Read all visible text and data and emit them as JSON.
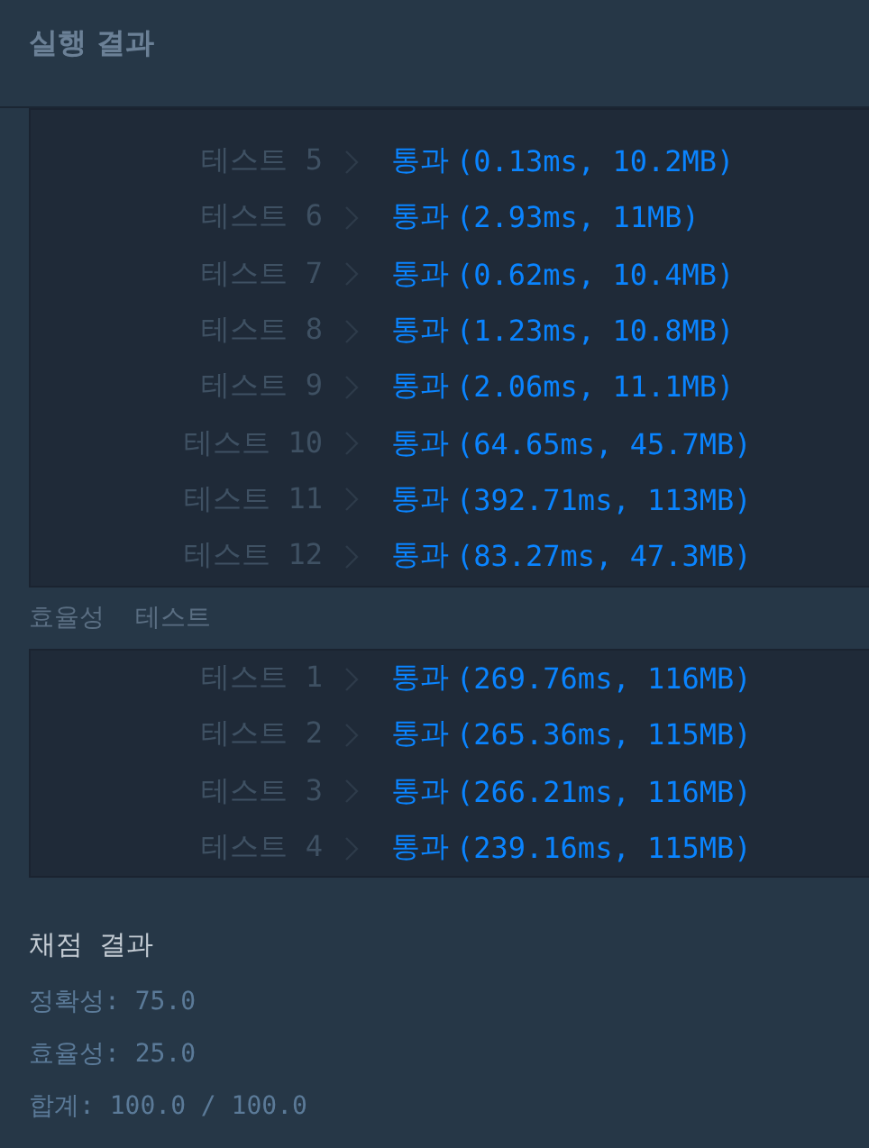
{
  "header": {
    "title": "실행 결과"
  },
  "accuracy_tests": [
    {
      "label": "테스트 5",
      "result": "통과",
      "detail": "(0.13ms, 10.2MB)"
    },
    {
      "label": "테스트 6",
      "result": "통과",
      "detail": "(2.93ms, 11MB)"
    },
    {
      "label": "테스트 7",
      "result": "통과",
      "detail": "(0.62ms, 10.4MB)"
    },
    {
      "label": "테스트 8",
      "result": "통과",
      "detail": "(1.23ms, 10.8MB)"
    },
    {
      "label": "테스트 9",
      "result": "통과",
      "detail": "(2.06ms, 11.1MB)"
    },
    {
      "label": "테스트 10",
      "result": "통과",
      "detail": "(64.65ms, 45.7MB)"
    },
    {
      "label": "테스트 11",
      "result": "통과",
      "detail": "(392.71ms, 113MB)"
    },
    {
      "label": "테스트 12",
      "result": "통과",
      "detail": "(83.27ms, 47.3MB)"
    }
  ],
  "efficiency": {
    "title": "효율성  테스트",
    "tests": [
      {
        "label": "테스트 1",
        "result": "통과",
        "detail": "(269.76ms, 116MB)"
      },
      {
        "label": "테스트 2",
        "result": "통과",
        "detail": "(265.36ms, 115MB)"
      },
      {
        "label": "테스트 3",
        "result": "통과",
        "detail": "(266.21ms, 116MB)"
      },
      {
        "label": "테스트 4",
        "result": "통과",
        "detail": "(239.16ms, 115MB)"
      }
    ]
  },
  "grading": {
    "title": "채점 결과",
    "lines": [
      "정확성: 75.0",
      "효율성: 25.0",
      "합계: 100.0 / 100.0"
    ]
  }
}
